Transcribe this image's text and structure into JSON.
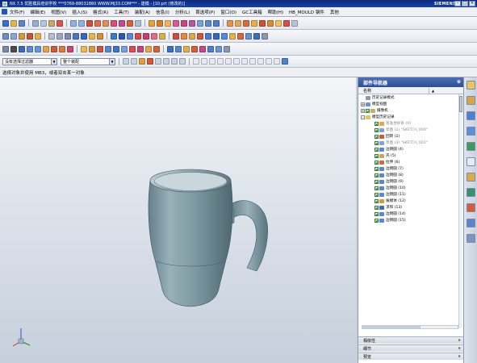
{
  "app": {
    "window_title": "NX 7.5 优胜模具培训学校  ***0769-88031860  WWW.MJ33.COM***  - 建模 - [10.prt (修改的)]",
    "brand": "SIEMENS"
  },
  "menubar": {
    "items": [
      "文件(F)",
      "编辑(E)",
      "视图(V)",
      "插入(S)",
      "格式(R)",
      "工具(T)",
      "装配(A)",
      "信息(I)",
      "分析(L)",
      "首选项(P)",
      "窗口(O)",
      "GC工具箱",
      "帮助(H)",
      "HB_MOULD 钢件",
      "其他"
    ]
  },
  "selection_bar": {
    "type_filter": "没有选择过滤器",
    "scope": "整个装配"
  },
  "status": {
    "prompt": "选择对象并使用 MB3，或者双击某一对象"
  },
  "navigator": {
    "title": "部件导航器",
    "column_name": "名称",
    "items": [
      {
        "label": "历史记录模式",
        "level": 0,
        "expander": "",
        "icon": "gear-icon",
        "checked": false,
        "dim": false
      },
      {
        "label": "模型视图",
        "level": 0,
        "expander": "+",
        "icon": "view-icon",
        "checked": false,
        "dim": false
      },
      {
        "label": "摄像机",
        "level": 0,
        "expander": "+",
        "icon": "camera-icon",
        "checked": true,
        "dim": false
      },
      {
        "label": "模型历史记录",
        "level": 0,
        "expander": "-",
        "icon": "folder-icon",
        "checked": false,
        "dim": false
      },
      {
        "label": "基准坐标系 (0)",
        "level": 1,
        "expander": "",
        "icon": "csys-icon",
        "checked": true,
        "dim": true
      },
      {
        "label": "草图 (1) \"SKETCH_000\"",
        "level": 1,
        "expander": "",
        "icon": "sketch-icon",
        "checked": true,
        "dim": true
      },
      {
        "label": "回转 (2)",
        "level": 1,
        "expander": "",
        "icon": "revolve-icon",
        "checked": true,
        "dim": false
      },
      {
        "label": "草图 (3) \"SKETCH_001\"",
        "level": 1,
        "expander": "",
        "icon": "sketch-icon",
        "checked": true,
        "dim": true
      },
      {
        "label": "边倒圆 (4)",
        "level": 1,
        "expander": "",
        "icon": "blend-icon",
        "checked": true,
        "dim": false
      },
      {
        "label": "壳 (5)",
        "level": 1,
        "expander": "",
        "icon": "shell-icon",
        "checked": true,
        "dim": false
      },
      {
        "label": "拉伸 (6)",
        "level": 1,
        "expander": "",
        "icon": "extrude-icon",
        "checked": true,
        "dim": false
      },
      {
        "label": "边倒圆 (7)",
        "level": 1,
        "expander": "",
        "icon": "blend-icon",
        "checked": true,
        "dim": false
      },
      {
        "label": "边倒圆 (8)",
        "level": 1,
        "expander": "",
        "icon": "blend-icon",
        "checked": true,
        "dim": false
      },
      {
        "label": "边倒圆 (9)",
        "level": 1,
        "expander": "",
        "icon": "blend-icon",
        "checked": true,
        "dim": false
      },
      {
        "label": "边倒圆 (10)",
        "level": 1,
        "expander": "",
        "icon": "blend-icon",
        "checked": true,
        "dim": false
      },
      {
        "label": "边倒圆 (11)",
        "level": 1,
        "expander": "",
        "icon": "blend-icon",
        "checked": true,
        "dim": false
      },
      {
        "label": "拔模体 (12)",
        "level": 1,
        "expander": "",
        "icon": "draft-icon",
        "checked": true,
        "dim": false
      },
      {
        "label": "求和 (13)",
        "level": 1,
        "expander": "",
        "icon": "unite-icon",
        "checked": true,
        "dim": false
      },
      {
        "label": "边倒圆 (14)",
        "level": 1,
        "expander": "",
        "icon": "blend-icon",
        "checked": true,
        "dim": false
      },
      {
        "label": "边倒圆 (15)",
        "level": 1,
        "expander": "",
        "icon": "blend-icon",
        "checked": true,
        "dim": false
      }
    ],
    "panels": [
      "相依性",
      "细节",
      "预览"
    ]
  },
  "colors": {
    "title_bar": "#1a3d9c",
    "navigator_header": "#3a5ca2",
    "part_body": "#7f9aa2",
    "viewport_top": "#f3f5f8",
    "viewport_bottom": "#c6cfdb"
  }
}
